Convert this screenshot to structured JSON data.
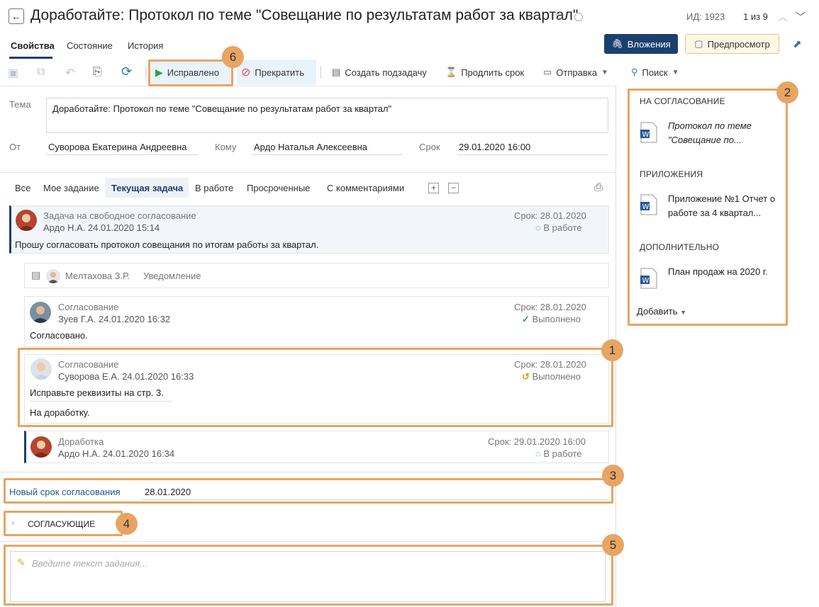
{
  "header": {
    "title": "Доработайте: Протокол по теме \"Совещание по результатам работ за квартал\"",
    "id_label": "ИД: 1923",
    "pager": "1 из 9"
  },
  "tabs": [
    "Свойства",
    "Состояние",
    "История"
  ],
  "buttons": {
    "attachments": "Вложения",
    "preview": "Предпросмотр"
  },
  "toolbar": {
    "fixed": "Исправлено",
    "stop": "Прекратить",
    "create_subtask": "Создать подзадачу",
    "extend": "Продлить срок",
    "send": "Отправка",
    "search": "Поиск"
  },
  "form": {
    "subject_label": "Тема",
    "subject": "Доработайте: Протокол по теме \"Совещание по результатам работ за квартал\"",
    "from_label": "От",
    "from": "Суворова Екатерина Андреевна",
    "to_label": "Кому",
    "to": "Ардо Наталья Алексеевна",
    "due_label": "Срок",
    "due": "29.01.2020 16:00"
  },
  "filters": [
    "Все",
    "Мое задание",
    "Текущая задача",
    "В работе",
    "Просроченные",
    "С комментариями"
  ],
  "tasks": {
    "t1": {
      "title": "Задача на свободное согласование",
      "meta": "Ардо Н.А.  24.01.2020 15:14",
      "due": "Срок: 28.01.2020",
      "status": "В работе",
      "text": "Прошу согласовать протокол совещания по итогам работы за квартал."
    },
    "t2": {
      "person": "Мелтахова З.Р.",
      "type": "Уведомление"
    },
    "t3": {
      "title": "Согласование",
      "meta": "Зуев Г.А.  24.01.2020 16:32",
      "due": "Срок: 28.01.2020",
      "status": "Выполнено",
      "text": "Согласовано."
    },
    "t4": {
      "title": "Согласование",
      "meta": "Суворова Е.А.  24.01.2020 16:33",
      "due": "Срок: 28.01.2020",
      "status": "Выполнено",
      "text": "Исправьте реквизиты на стр. 3.",
      "text2": "На доработку."
    },
    "t5": {
      "title": "Доработка",
      "meta": "Ардо Н.А.  24.01.2020 16:34",
      "due": "Срок: 29.01.2020 16:00",
      "status": "В работе"
    }
  },
  "new_due": {
    "label": "Новый срок согласования",
    "value": "28.01.2020"
  },
  "approvers": {
    "label": "СОГЛАСУЮЩИЕ"
  },
  "task_input": {
    "placeholder": "Введите текст задания..."
  },
  "sidebar": {
    "section1": "НА СОГЛАСОВАНИЕ",
    "doc1": "Протокол по теме \"Совещание по...",
    "section2": "ПРИЛОЖЕНИЯ",
    "doc2": "Приложение №1 Отчет о работе за 4 квартал...",
    "section3": "ДОПОЛНИТЕЛЬНО",
    "doc3": "План продаж на 2020 г.",
    "add": "Добавить"
  },
  "callouts": [
    "1",
    "2",
    "3",
    "4",
    "5",
    "6"
  ],
  "colors": {
    "accent": "#1c3f6e",
    "highlight": "#e8a463",
    "done": "#3a9e3a"
  }
}
